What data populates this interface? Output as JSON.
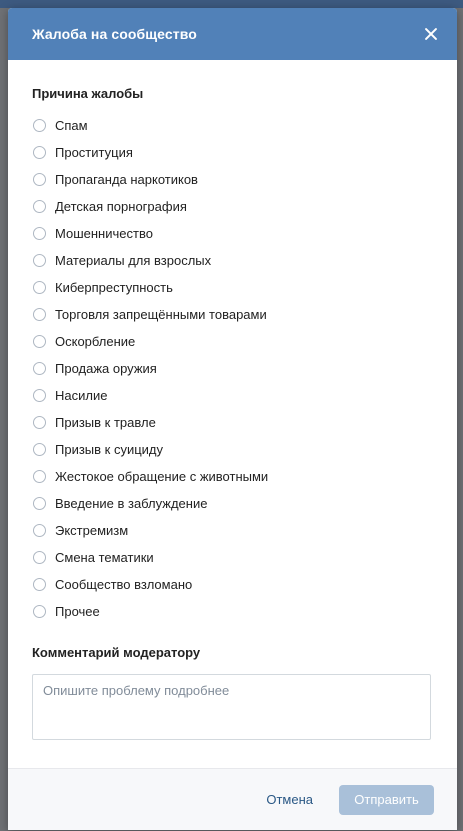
{
  "dialog": {
    "title": "Жалоба на сообщество",
    "close_icon": "close-icon"
  },
  "reason_section": {
    "label": "Причина жалобы",
    "options": [
      "Спам",
      "Проституция",
      "Пропаганда наркотиков",
      "Детская порнография",
      "Мошенничество",
      "Материалы для взрослых",
      "Киберпреступность",
      "Торговля запрещёнными товарами",
      "Оскорбление",
      "Продажа оружия",
      "Насилие",
      "Призыв к травле",
      "Призыв к суициду",
      "Жестокое обращение с животными",
      "Введение в заблуждение",
      "Экстремизм",
      "Смена тематики",
      "Сообщество взломано",
      "Прочее"
    ]
  },
  "comment_section": {
    "label": "Комментарий модератору",
    "placeholder": "Опишите проблему подробнее",
    "value": ""
  },
  "footer": {
    "cancel_label": "Отмена",
    "submit_label": "Отправить"
  },
  "colors": {
    "header": "#5181b8",
    "submit_disabled": "#a9c0d9",
    "link": "#2a5885"
  }
}
